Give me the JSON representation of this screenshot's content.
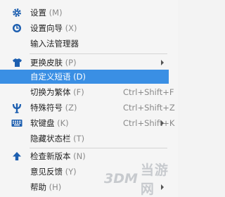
{
  "menu": {
    "items": [
      {
        "label": "设置",
        "key": "(M)",
        "icon": "gear-icon"
      },
      {
        "label": "设置向导",
        "key": "(X)",
        "icon": "wizard-icon"
      },
      {
        "label": "输入法管理器",
        "key": ""
      },
      {
        "label": "更换皮肤",
        "key": "(P)",
        "icon": "shirt-icon",
        "submenu": true
      },
      {
        "label": "自定义短语",
        "key": "(D)",
        "selected": true
      },
      {
        "label": "切换为繁体",
        "key": "(F)",
        "shortcut": "Ctrl+Shift+F"
      },
      {
        "label": "特殊符号",
        "key": "(Z)",
        "icon": "psi-symbol-icon",
        "shortcut": "Ctrl+Shift+Z"
      },
      {
        "label": "软键盘",
        "key": "(K)",
        "icon": "keyboard-icon",
        "shortcut": "Ctrl+Shift+K",
        "submenu": true
      },
      {
        "label": "隐藏状态栏",
        "key": "(T)"
      },
      {
        "label": "检查新版本",
        "key": "(N)",
        "icon": "arrow-up-icon"
      },
      {
        "label": "意见反馈",
        "key": "(Y)"
      },
      {
        "label": "帮助",
        "key": "(H)",
        "submenu": true
      }
    ],
    "selected_color": "#3a8fe4",
    "icon_color": "#1d5fb0"
  },
  "watermark": {
    "logo": "3DM",
    "text": "当游网"
  }
}
